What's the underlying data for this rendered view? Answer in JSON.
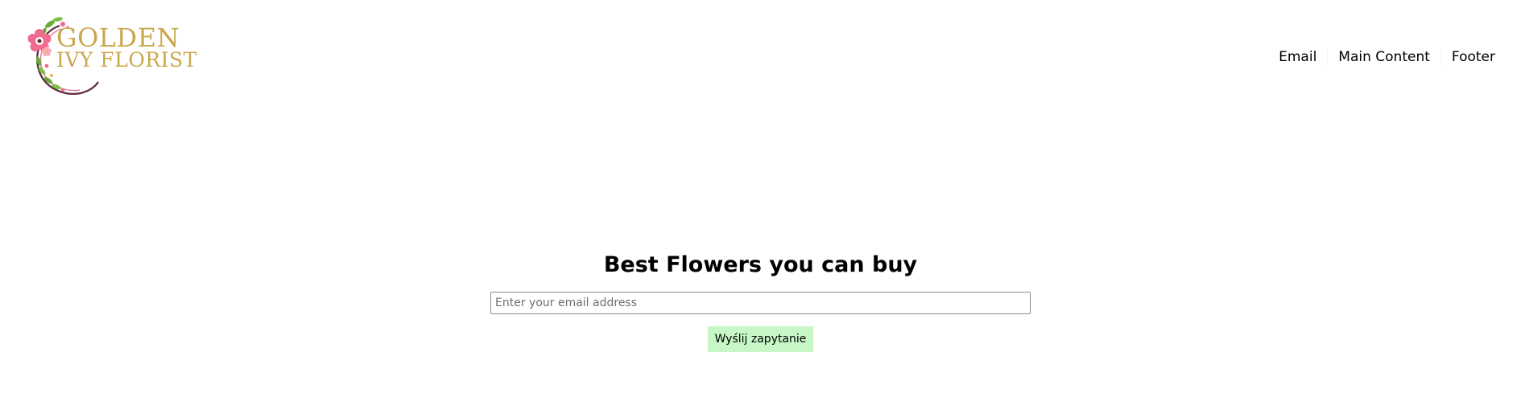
{
  "header": {
    "logo": {
      "line1": "GOLDEN",
      "line2": "IVY FLORIST",
      "text_color": "#c9a84c",
      "flower_color": "#f06b8e",
      "leaf_color": "#6aa83a",
      "ring_color": "#5a2a3a"
    },
    "nav": {
      "items": [
        {
          "label": "Email"
        },
        {
          "label": "Main Content"
        },
        {
          "label": "Footer"
        }
      ]
    }
  },
  "main": {
    "title": "Best Flowers you can buy",
    "email_input": {
      "value": "",
      "placeholder": "Enter your email address"
    },
    "submit_label": "Wyślij zapytanie",
    "submit_color": "#c7f7c7"
  }
}
